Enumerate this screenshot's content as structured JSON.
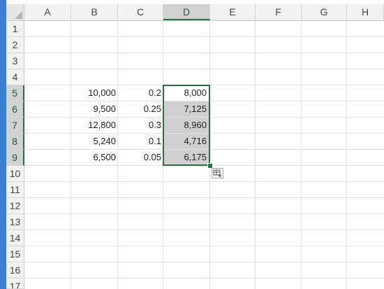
{
  "columns": [
    "A",
    "B",
    "C",
    "D",
    "E",
    "F",
    "G",
    "H"
  ],
  "selected_column": "D",
  "rows": [
    "1",
    "2",
    "3",
    "4",
    "5",
    "6",
    "7",
    "8",
    "9",
    "10",
    "11",
    "12",
    "13",
    "14",
    "15",
    "16",
    "17"
  ],
  "selected_rows": [
    "5",
    "6",
    "7",
    "8",
    "9"
  ],
  "cells": {
    "B5": "10,000",
    "C5": "0.2",
    "D5": "8,000",
    "B6": "9,500",
    "C6": "0.25",
    "D6": "7,125",
    "B7": "12,800",
    "C7": "0.3",
    "D7": "8,960",
    "B8": "5,240",
    "C8": "0.1",
    "D8": "4,716",
    "B9": "6,500",
    "C9": "0.05",
    "D9": "6,175"
  },
  "selection_range": "D5:D9",
  "icons": {
    "quick_analysis": "quick-analysis-icon",
    "select_all": "select-all-icon"
  },
  "colors": {
    "accent": "#217346",
    "selection_fill": "#d0d0d0",
    "window_edge": "#3a7fd1"
  }
}
